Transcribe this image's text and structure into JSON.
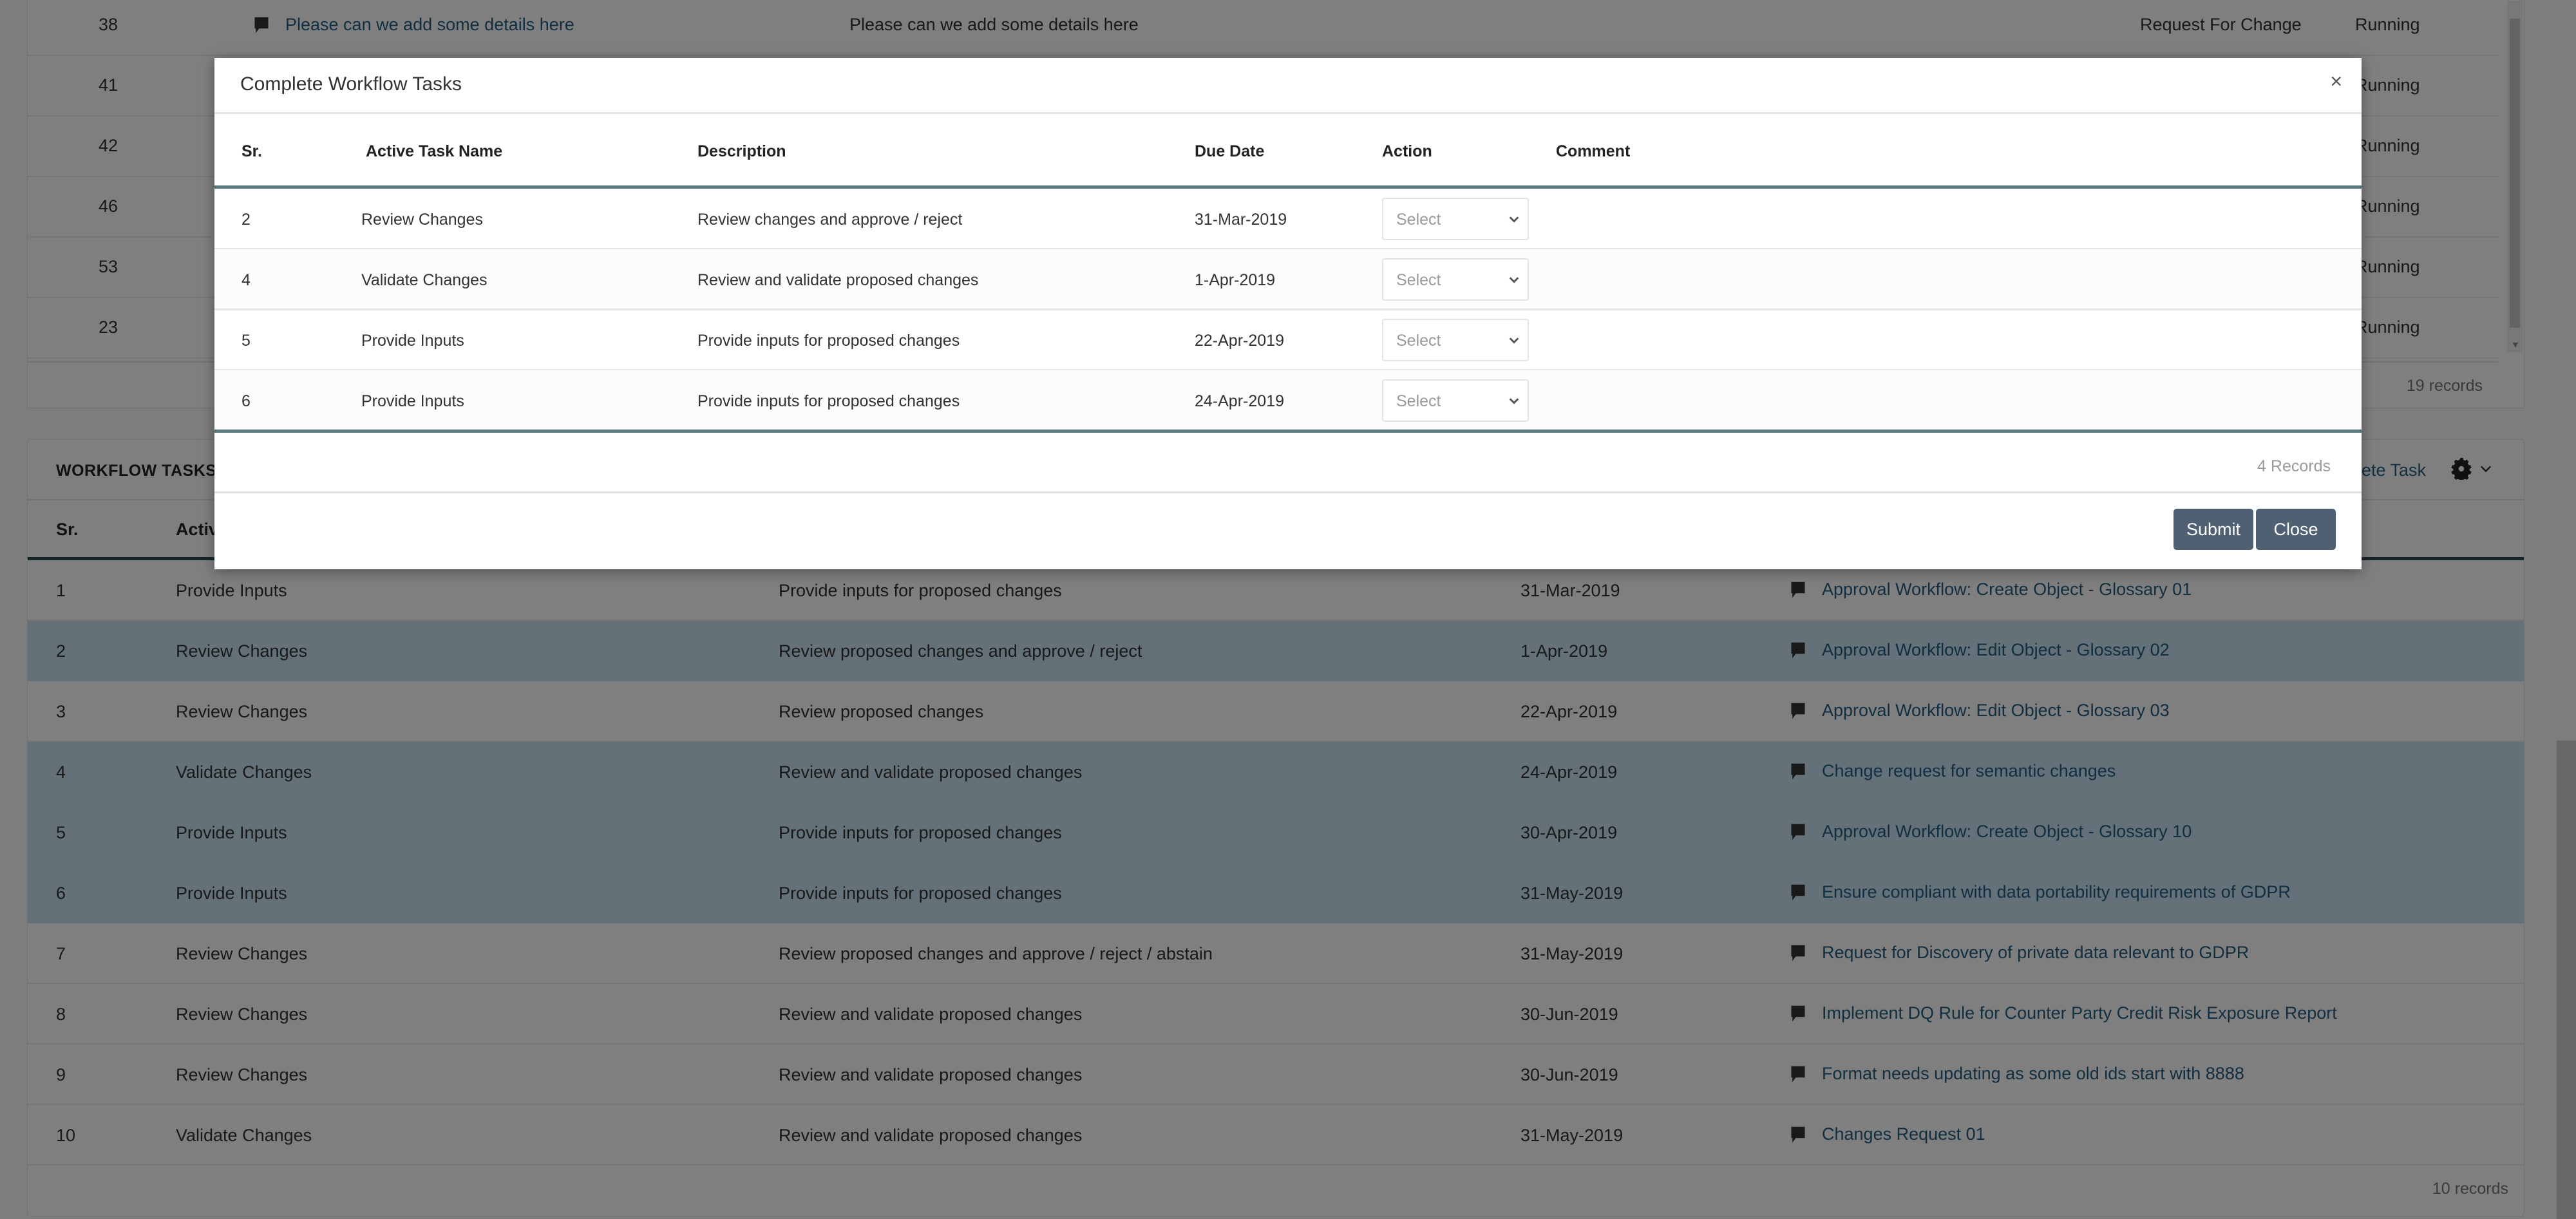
{
  "requests_panel": {
    "rows": [
      {
        "id": "38",
        "title": "Please can we add some details here",
        "description": "Please can we add some details here",
        "type": "Request For Change",
        "status": "Running"
      },
      {
        "id": "41",
        "status": "Running"
      },
      {
        "id": "42",
        "status": "Running"
      },
      {
        "id": "46",
        "status": "Running"
      },
      {
        "id": "53",
        "status": "Running"
      },
      {
        "id": "23",
        "status": "Running"
      }
    ],
    "records": "19 records"
  },
  "workflow_tasks": {
    "title": "WORKFLOW TASKS",
    "complete_task_link": "Complete Task",
    "columns": {
      "sr": "Sr.",
      "name": "Active Task Name"
    },
    "rows": [
      {
        "sr": "1",
        "name": "Provide Inputs",
        "description": "Provide inputs for proposed changes",
        "due": "31-Mar-2019",
        "request": "Approval Workflow: Create Object - Glossary 01",
        "selected": false
      },
      {
        "sr": "2",
        "name": "Review Changes",
        "description": "Review proposed changes and approve / reject",
        "due": "1-Apr-2019",
        "request": "Approval Workflow: Edit Object - Glossary 02",
        "selected": true
      },
      {
        "sr": "3",
        "name": "Review Changes",
        "description": "Review proposed changes",
        "due": "22-Apr-2019",
        "request": "Approval Workflow: Edit Object - Glossary 03",
        "selected": false
      },
      {
        "sr": "4",
        "name": "Validate Changes",
        "description": "Review and validate proposed changes",
        "due": "24-Apr-2019",
        "request": "Change request for semantic changes",
        "selected": true
      },
      {
        "sr": "5",
        "name": "Provide Inputs",
        "description": "Provide inputs for proposed changes",
        "due": "30-Apr-2019",
        "request": "Approval Workflow: Create Object - Glossary 10",
        "selected": true
      },
      {
        "sr": "6",
        "name": "Provide Inputs",
        "description": "Provide inputs for proposed changes",
        "due": "31-May-2019",
        "request": "Ensure compliant with data portability requirements of GDPR",
        "selected": true
      },
      {
        "sr": "7",
        "name": "Review Changes",
        "description": "Review proposed changes and approve / reject / abstain",
        "due": "31-May-2019",
        "request": "Request for Discovery of private data relevant to GDPR",
        "selected": false
      },
      {
        "sr": "8",
        "name": "Review Changes",
        "description": "Review and validate proposed changes",
        "due": "30-Jun-2019",
        "request": "Implement DQ Rule for Counter Party Credit Risk Exposure Report",
        "selected": false
      },
      {
        "sr": "9",
        "name": "Review Changes",
        "description": "Review and validate proposed changes",
        "due": "30-Jun-2019",
        "request": "Format needs updating as some old ids start with 8888",
        "selected": false
      },
      {
        "sr": "10",
        "name": "Validate Changes",
        "description": "Review and validate proposed changes",
        "due": "31-May-2019",
        "request": "Changes Request 01",
        "selected": false
      }
    ],
    "records": "10 records"
  },
  "modal": {
    "title": "Complete Workflow Tasks",
    "close_x": "×",
    "columns": {
      "sr": "Sr.",
      "name": "Active Task Name",
      "description": "Description",
      "due": "Due Date",
      "action": "Action",
      "comment": "Comment"
    },
    "rows": [
      {
        "sr": "2",
        "name": "Review Changes",
        "description": "Review changes and approve / reject",
        "due": "31-Mar-2019",
        "action": "Select"
      },
      {
        "sr": "4",
        "name": "Validate Changes",
        "description": "Review and validate proposed changes",
        "due": "1-Apr-2019",
        "action": "Select"
      },
      {
        "sr": "5",
        "name": "Provide Inputs",
        "description": "Provide inputs for proposed changes",
        "due": "22-Apr-2019",
        "action": "Select"
      },
      {
        "sr": "6",
        "name": "Provide Inputs",
        "description": "Provide inputs for proposed changes",
        "due": "24-Apr-2019",
        "action": "Select"
      }
    ],
    "records": "4 Records",
    "submit_label": "Submit",
    "close_label": "Close"
  },
  "colors": {
    "link": "#245e82",
    "selected_row": "#c9e3f0",
    "button": "#4f6073",
    "header_rule": "#2e4d52"
  }
}
